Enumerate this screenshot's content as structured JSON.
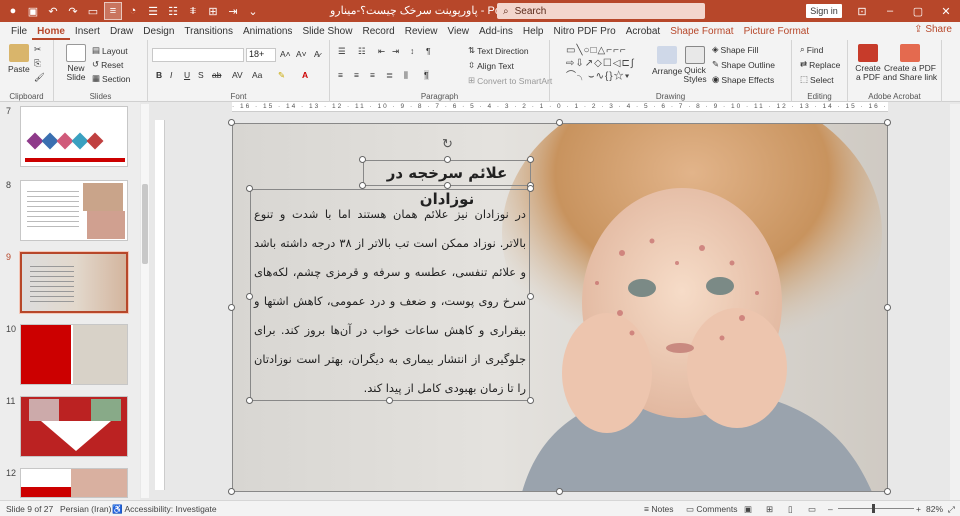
{
  "window": {
    "doc_title": "پاورپوینت سرخک چیست؟-مینارو - PowerPoint",
    "search_placeholder": "Search",
    "sign_in": "Sign in"
  },
  "menu": [
    "File",
    "Home",
    "Insert",
    "Draw",
    "Design",
    "Transitions",
    "Animations",
    "Slide Show",
    "Record",
    "Review",
    "View",
    "Add-ins",
    "Help",
    "Nitro PDF Pro",
    "Acrobat"
  ],
  "menu_context": [
    "Shape Format",
    "Picture Format"
  ],
  "share_label": "Share",
  "ribbon": {
    "clipboard": {
      "label": "Clipboard",
      "paste": "Paste"
    },
    "slides": {
      "label": "Slides",
      "new_slide": "New Slide",
      "layout": "Layout",
      "reset": "Reset",
      "section": "Section"
    },
    "font": {
      "label": "Font",
      "size": "18+"
    },
    "paragraph": {
      "label": "Paragraph",
      "text_direction": "Text Direction",
      "align_text": "Align Text",
      "convert": "Convert to SmartArt"
    },
    "drawing": {
      "label": "Drawing",
      "arrange": "Arrange",
      "quick_styles": "Quick Styles",
      "shape_fill": "Shape Fill",
      "shape_outline": "Shape Outline",
      "shape_effects": "Shape Effects"
    },
    "editing": {
      "label": "Editing",
      "find": "Find",
      "replace": "Replace",
      "select": "Select"
    },
    "acrobat": {
      "label": "Adobe Acrobat",
      "create_pdf": "Create a PDF",
      "create_share": "Create a PDF and Share link"
    }
  },
  "thumbnails": [
    {
      "num": "7",
      "selected": false
    },
    {
      "num": "8",
      "selected": false
    },
    {
      "num": "9",
      "selected": true
    },
    {
      "num": "10",
      "selected": false
    },
    {
      "num": "11",
      "selected": false
    },
    {
      "num": "12",
      "selected": false
    }
  ],
  "slide": {
    "title": "علائم سرخجه در نوزادان",
    "body": "در نوزادان نیز علائم همان هستند اما با شدت و تنوع بالاتر. نوزاد ممکن است تب بالاتر از ۳۸ درجه داشته باشد و علائم تنفسی، عطسه و سرفه و قرمزی چشم، لکه‌های سرخ روی پوست، و ضعف و درد عمومی، کاهش اشتها و بیقراری و کاهش ساعات خواب در آن‌ها بروز کند. برای جلوگیری از انتشار بیماری به دیگران، بهتر است نوزادتان را تا زمان بهبودی کامل از پیدا کند."
  },
  "ruler_text": "· 16 · 15 · 14 · 13 · 12 · 11 · 10 · 9 · 8 · 7 · 6 · 5 · 4 · 3 · 2 · 1 · 0 · 1 · 2 · 3 · 4 · 5 · 6 · 7 · 8 · 9 · 10 · 11 · 12 · 13 · 14 · 15 · 16 ·",
  "status": {
    "slide": "Slide 9 of 27",
    "language": "Persian (Iran)",
    "accessibility": "Accessibility: Investigate",
    "notes": "Notes",
    "comments": "Comments",
    "zoom": "82%"
  },
  "colors": {
    "accent": "#b7472a"
  }
}
